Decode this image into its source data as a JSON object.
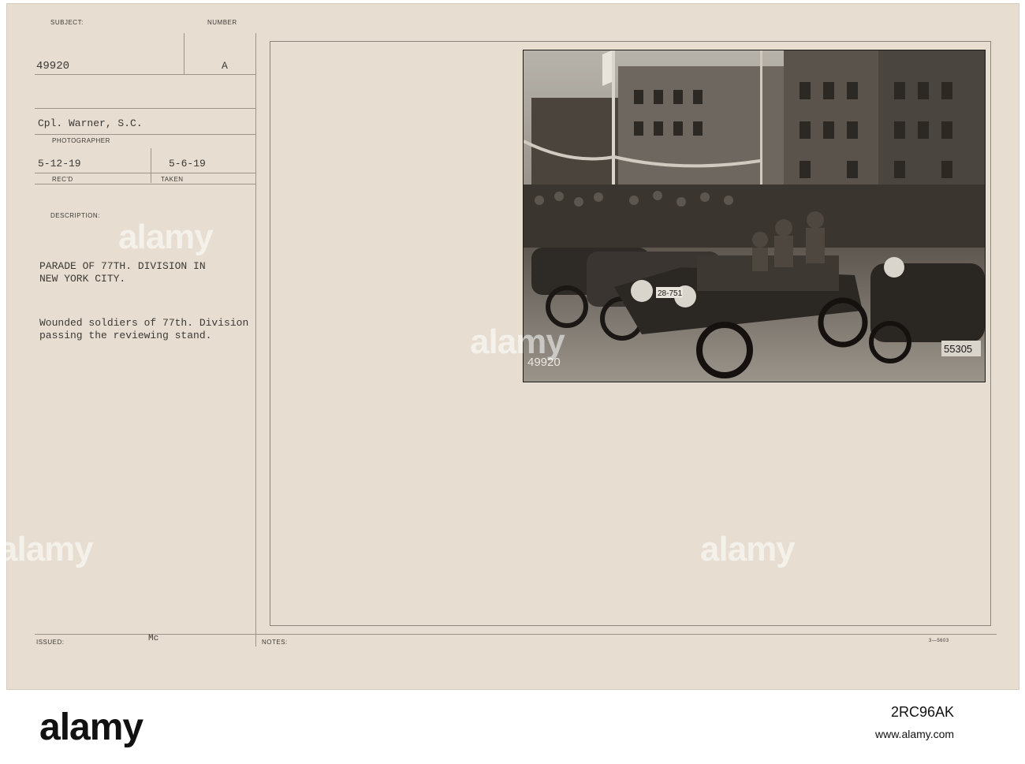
{
  "record": {
    "subject_label": "SUBJECT:",
    "number_label": "NUMBER",
    "subject_value": "49920",
    "number_value": "A",
    "photographer_value": "Cpl. Warner, S.C.",
    "photographer_label": "PHOTOGRAPHER",
    "received_value": "5-12-19",
    "received_label": "REC'D",
    "taken_value": "5-6-19",
    "taken_label": "TAKEN",
    "description_label": "DESCRIPTION:",
    "description_title_1": "PARADE OF 77TH. DIVISION IN",
    "description_title_2": "NEW YORK CITY.",
    "description_body_1": "Wounded soldiers of 77th. Division",
    "description_body_2": "passing the reviewing stand.",
    "issued_label": "ISSUED:",
    "issued_value": "Mc",
    "notes_label": "NOTES:",
    "form_code": "3—5603"
  },
  "photo": {
    "negative_number": "49920",
    "plate_1": "28-751",
    "plate_2": "55305"
  },
  "watermarks": {
    "text": "alamy"
  },
  "footer": {
    "logo": "alamy",
    "image_id": "2RC96AK",
    "url": "www.alamy.com"
  }
}
